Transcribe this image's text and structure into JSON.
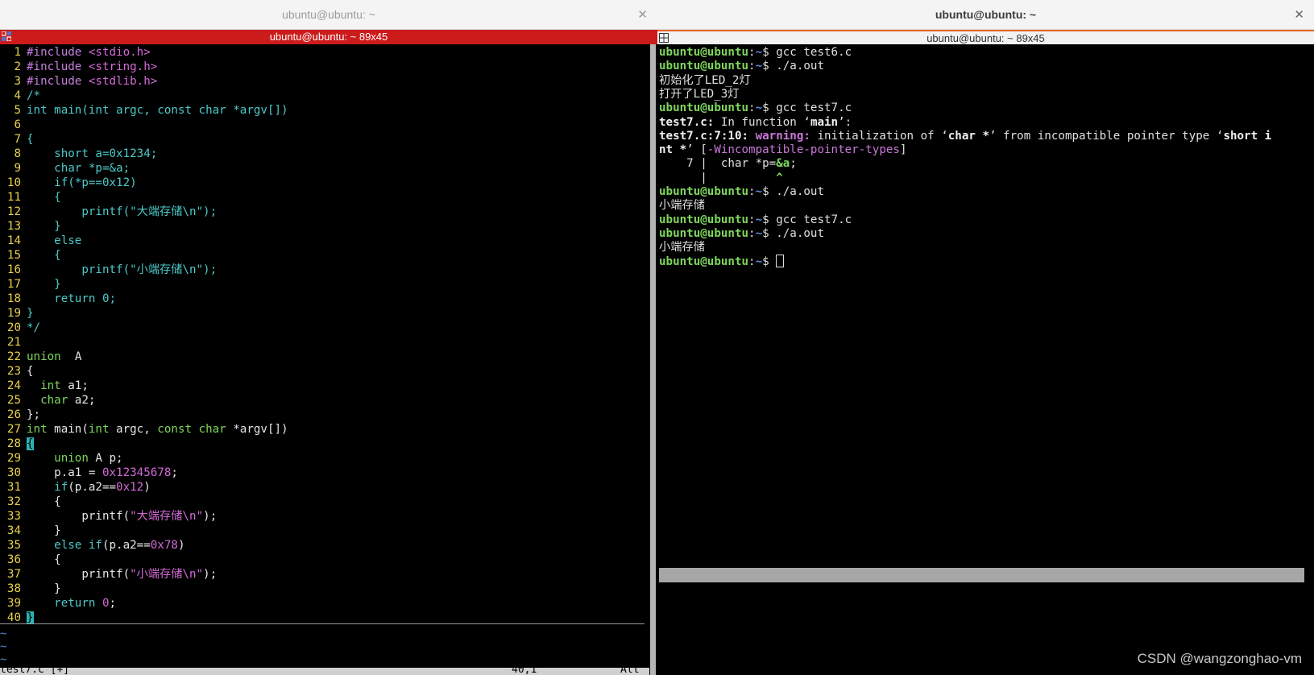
{
  "window_left": {
    "title": "ubuntu@ubuntu: ~",
    "close": "✕"
  },
  "window_right": {
    "title": "ubuntu@ubuntu: ~",
    "close": "✕"
  },
  "inner_left": {
    "title": "ubuntu@ubuntu: ~ 89x45"
  },
  "inner_right": {
    "title": "ubuntu@ubuntu: ~ 89x45"
  },
  "vim": {
    "lines": [
      [
        [
          "pp",
          "#include "
        ],
        [
          "str",
          "<stdio.h>"
        ]
      ],
      [
        [
          "pp",
          "#include "
        ],
        [
          "str",
          "<string.h>"
        ]
      ],
      [
        [
          "pp",
          "#include "
        ],
        [
          "str",
          "<stdlib.h>"
        ]
      ],
      [
        [
          "cm",
          "/*"
        ]
      ],
      [
        [
          "cm",
          "int main(int argc, const char *argv[])"
        ]
      ],
      [],
      [
        [
          "cm",
          "{"
        ]
      ],
      [
        [
          "cm",
          "    short a=0x1234;"
        ]
      ],
      [
        [
          "cm",
          "    char *p=&a;"
        ]
      ],
      [
        [
          "cm",
          "    if(*p==0x12)"
        ]
      ],
      [
        [
          "cm",
          "    {"
        ]
      ],
      [
        [
          "cm",
          "        printf(\"大端存储\\n\");"
        ]
      ],
      [
        [
          "cm",
          "    }"
        ]
      ],
      [
        [
          "cm",
          "    else"
        ]
      ],
      [
        [
          "cm",
          "    {"
        ]
      ],
      [
        [
          "cm",
          "        printf(\"小端存储\\n\");"
        ]
      ],
      [
        [
          "cm",
          "    }"
        ]
      ],
      [
        [
          "cm",
          "    return 0;"
        ]
      ],
      [
        [
          "cm",
          "}"
        ]
      ],
      [
        [
          "cm",
          "*/"
        ]
      ],
      [],
      [
        [
          "ty",
          "union"
        ],
        [
          "",
          "  "
        ],
        [
          "",
          "A"
        ]
      ],
      [
        [
          "",
          "{"
        ]
      ],
      [
        [
          "",
          ""
        ],
        [
          "ty",
          "  int"
        ],
        [
          "",
          " a1;"
        ]
      ],
      [
        [
          "",
          ""
        ],
        [
          "ty",
          "  char"
        ],
        [
          "",
          " a2;"
        ]
      ],
      [
        [
          "",
          "};"
        ]
      ],
      [
        [
          "ty",
          "int"
        ],
        [
          "",
          " main("
        ],
        [
          "ty",
          "int"
        ],
        [
          "",
          " argc, "
        ],
        [
          "ty",
          "const char"
        ],
        [
          "",
          " *argv[])"
        ]
      ],
      [
        [
          "cur",
          "{"
        ]
      ],
      [
        [
          "ty",
          "    union"
        ],
        [
          "",
          " A p;"
        ]
      ],
      [
        [
          "",
          "    p.a1 = "
        ],
        [
          "num",
          "0x12345678"
        ],
        [
          "",
          ";"
        ]
      ],
      [
        [
          "kw",
          "    if"
        ],
        [
          "",
          "(p.a2=="
        ],
        [
          "num",
          "0x12"
        ],
        [
          "",
          ")"
        ]
      ],
      [
        [
          "",
          "    {"
        ]
      ],
      [
        [
          "",
          "        printf("
        ],
        [
          "str",
          "\"大端存储\\n\""
        ],
        [
          "",
          ");"
        ]
      ],
      [
        [
          "",
          "    }"
        ]
      ],
      [
        [
          "kw",
          "    else if"
        ],
        [
          "",
          "(p.a2=="
        ],
        [
          "num",
          "0x78"
        ],
        [
          "",
          ")"
        ]
      ],
      [
        [
          "",
          "    {"
        ]
      ],
      [
        [
          "",
          "        printf("
        ],
        [
          "str",
          "\"小端存储\\n\""
        ],
        [
          "",
          ");"
        ]
      ],
      [
        [
          "",
          "    }"
        ]
      ],
      [
        [
          "kw",
          "    return"
        ],
        [
          "",
          " "
        ],
        [
          "num",
          "0"
        ],
        [
          "",
          ";"
        ]
      ],
      [
        [
          "cur",
          "}"
        ]
      ]
    ],
    "tildes": [
      "~",
      "~",
      "~"
    ],
    "status_left": "test7.c [+]",
    "status_pos": "40,1",
    "status_right": "All"
  },
  "terminal": {
    "prompt_user": "ubuntu@ubuntu",
    "prompt_path": "~",
    "prompt_sym": "$",
    "lines": [
      [
        [
          "pr",
          "ubuntu@ubuntu"
        ],
        [
          "",
          ":"
        ],
        [
          "pth",
          "~"
        ],
        [
          "",
          "$ gcc test6.c"
        ]
      ],
      [
        [
          "pr",
          "ubuntu@ubuntu"
        ],
        [
          "",
          ":"
        ],
        [
          "pth",
          "~"
        ],
        [
          "",
          "$ ./a.out"
        ]
      ],
      [
        [
          "",
          "初始化了LED_2灯"
        ]
      ],
      [
        [
          "",
          "打开了LED_3灯"
        ]
      ],
      [
        [
          "pr",
          "ubuntu@ubuntu"
        ],
        [
          "",
          ":"
        ],
        [
          "pth",
          "~"
        ],
        [
          "",
          "$ gcc test7.c"
        ]
      ],
      [
        [
          "b",
          "test7.c:"
        ],
        [
          "",
          " In function ‘"
        ],
        [
          "b",
          "main"
        ],
        [
          "",
          "’:"
        ]
      ],
      [
        [
          "b",
          "test7.c:7:10: "
        ],
        [
          "warn",
          "warning: "
        ],
        [
          "",
          "initialization of ‘"
        ],
        [
          "b",
          "char *"
        ],
        [
          "",
          "’ from incompatible pointer type ‘"
        ],
        [
          "b",
          "short i"
        ]
      ],
      [
        [
          "b",
          "nt *"
        ],
        [
          "",
          "’ ["
        ],
        [
          "opt",
          "-Wincompatible-pointer-types"
        ],
        [
          "",
          "]"
        ]
      ],
      [
        [
          "",
          "    7 |  char *p="
        ],
        [
          "caret",
          "&a"
        ],
        [
          "",
          ";"
        ]
      ],
      [
        [
          "",
          "      |          "
        ],
        [
          "caret",
          "^"
        ]
      ],
      [
        [
          "pr",
          "ubuntu@ubuntu"
        ],
        [
          "",
          ":"
        ],
        [
          "pth",
          "~"
        ],
        [
          "",
          "$ ./a.out"
        ]
      ],
      [
        [
          "",
          "小端存储"
        ]
      ],
      [
        [
          "pr",
          "ubuntu@ubuntu"
        ],
        [
          "",
          ":"
        ],
        [
          "pth",
          "~"
        ],
        [
          "",
          "$ gcc test7.c"
        ]
      ],
      [
        [
          "pr",
          "ubuntu@ubuntu"
        ],
        [
          "",
          ":"
        ],
        [
          "pth",
          "~"
        ],
        [
          "",
          "$ ./a.out"
        ]
      ],
      [
        [
          "",
          "小端存储"
        ]
      ],
      [
        [
          "pr",
          "ubuntu@ubuntu"
        ],
        [
          "",
          ":"
        ],
        [
          "pth",
          "~"
        ],
        [
          "",
          "$ "
        ],
        [
          "cursor",
          ""
        ]
      ]
    ]
  },
  "watermark": "CSDN @wangzonghao-vm"
}
